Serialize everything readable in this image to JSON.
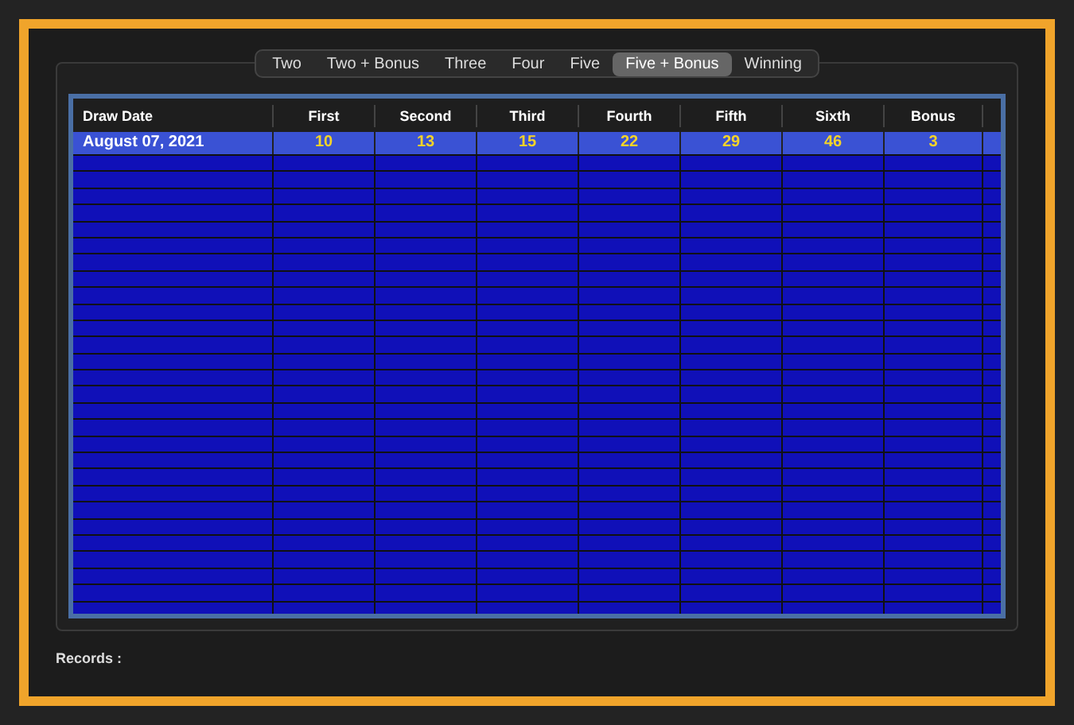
{
  "tabs": [
    {
      "label": "Two",
      "selected": false
    },
    {
      "label": "Two + Bonus",
      "selected": false
    },
    {
      "label": "Three",
      "selected": false
    },
    {
      "label": "Four",
      "selected": false
    },
    {
      "label": "Five",
      "selected": false
    },
    {
      "label": "Five + Bonus",
      "selected": true
    },
    {
      "label": "Winning",
      "selected": false
    }
  ],
  "table": {
    "columns": [
      "Draw Date",
      "First",
      "Second",
      "Third",
      "Fourth",
      "Fifth",
      "Sixth",
      "Bonus"
    ],
    "rows": [
      {
        "selected": true,
        "cells": [
          "August 07, 2021",
          "10",
          "13",
          "15",
          "22",
          "29",
          "46",
          "3"
        ]
      }
    ]
  },
  "status_bar": {
    "label": "Records :"
  }
}
